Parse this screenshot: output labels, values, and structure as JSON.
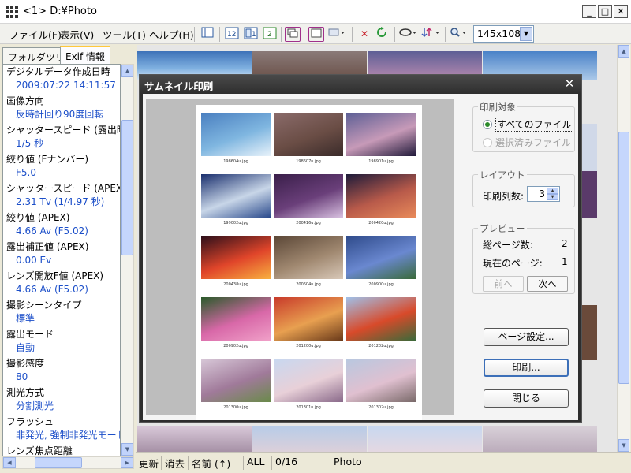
{
  "window": {
    "title": "<1> D:¥Photo",
    "minimize": "_",
    "maximize": "□",
    "close": "✕"
  },
  "menu": [
    "ファイル(F)",
    "表示(V)",
    "ツール(T)",
    "ヘルプ(H)"
  ],
  "toolbar": {
    "size_value": "145x108"
  },
  "left_panel": {
    "tabs": [
      "フォルダツリー",
      "Exif 情報"
    ],
    "active_tab": "Exif 情報",
    "exif": [
      {
        "label": "デジタルデータ作成日時",
        "value": "2009:07:22 14:11:57"
      },
      {
        "label": "画像方向",
        "value": "反時計回り90度回転"
      },
      {
        "label": "シャッタースピード (露出時間)",
        "value": "1/5 秒"
      },
      {
        "label": "絞り値 (Fナンバー)",
        "value": "F5.0"
      },
      {
        "label": "シャッタースピード (APEX)",
        "value": "2.31 Tv (1/4.97 秒)"
      },
      {
        "label": "絞り値 (APEX)",
        "value": "4.66 Av (F5.02)"
      },
      {
        "label": "露出補正値 (APEX)",
        "value": "0.00 Ev"
      },
      {
        "label": "レンズ開放F値 (APEX)",
        "value": "4.66 Av (F5.02)"
      },
      {
        "label": "撮影シーンタイプ",
        "value": "標準"
      },
      {
        "label": "露出モード",
        "value": "自動"
      },
      {
        "label": "撮影感度",
        "value": "80"
      },
      {
        "label": "測光方式",
        "value": "分割測光"
      },
      {
        "label": "フラッシュ",
        "value": "非発光, 強制非発光モード"
      },
      {
        "label": "レンズ焦点距離",
        "value": ""
      }
    ]
  },
  "statusbar": {
    "refresh": "更新",
    "delete": "消去",
    "sort": "名前 (↑)",
    "filter": "ALL",
    "count": "0/16",
    "folder": "Photo"
  },
  "dialog": {
    "title": "サムネイル印刷",
    "close": "✕",
    "thumbnails": [
      {
        "name": "198604u.jpg",
        "colors": [
          "#4a7fc0",
          "#7fb6e0",
          "#e8f2fa"
        ]
      },
      {
        "name": "198607u.jpg",
        "colors": [
          "#8a6b6a",
          "#6a4d45",
          "#3a2b2a"
        ]
      },
      {
        "name": "198901u.jpg",
        "colors": [
          "#5d5f95",
          "#c79ab8",
          "#201a3a"
        ]
      },
      {
        "name": "199002u.jpg",
        "colors": [
          "#1a2f6e",
          "#c8d6e8",
          "#2a4a8c"
        ]
      },
      {
        "name": "200416u.jpg",
        "colors": [
          "#3a1f4a",
          "#6a3f7a",
          "#d8c0e0"
        ]
      },
      {
        "name": "200420u.jpg",
        "colors": [
          "#1e1b3a",
          "#b85a4a",
          "#e88a5a"
        ]
      },
      {
        "name": "200438u.jpg",
        "colors": [
          "#2a0e1a",
          "#e0452a",
          "#f8b040"
        ]
      },
      {
        "name": "200604u.jpg",
        "colors": [
          "#5a4636",
          "#a08870",
          "#d8c8b8"
        ]
      },
      {
        "name": "200900u.jpg",
        "colors": [
          "#2e4a8a",
          "#6a88d0",
          "#3a6a3a"
        ]
      },
      {
        "name": "200902u.jpg",
        "colors": [
          "#2a5a2a",
          "#d868a8",
          "#f0a0c8"
        ]
      },
      {
        "name": "201200u.jpg",
        "colors": [
          "#c83a2a",
          "#e8a050",
          "#6a3a1a"
        ]
      },
      {
        "name": "201202u.jpg",
        "colors": [
          "#a0c0e8",
          "#d84a2a",
          "#3a6a3a"
        ]
      },
      {
        "name": "201300u.jpg",
        "colors": [
          "#d8c8d8",
          "#a07a9a",
          "#6a8a4a"
        ]
      },
      {
        "name": "201301u.jpg",
        "colors": [
          "#c8d8f0",
          "#e8d0d8",
          "#8a6a8a"
        ]
      },
      {
        "name": "201302u.jpg",
        "colors": [
          "#b8c8e0",
          "#e0c0d0",
          "#7a6a6a"
        ]
      }
    ],
    "target": {
      "title": "印刷対象",
      "all_files": "すべてのファイル",
      "selected_files": "選択済みファイル",
      "selected_option": "all_files"
    },
    "layout": {
      "title": "レイアウト",
      "columns_label": "印刷列数:",
      "columns_value": "3"
    },
    "preview": {
      "title": "プレビュー",
      "total_pages_label": "総ページ数:",
      "total_pages_value": "2",
      "current_page_label": "現在のページ:",
      "current_page_value": "1",
      "prev": "前へ",
      "next": "次へ"
    },
    "buttons": {
      "page_setup": "ページ設定...",
      "print": "印刷...",
      "close": "閉じる"
    }
  },
  "colors": {
    "accent": "#1c4fc9",
    "dialog_frame": "#2e2e2e"
  }
}
